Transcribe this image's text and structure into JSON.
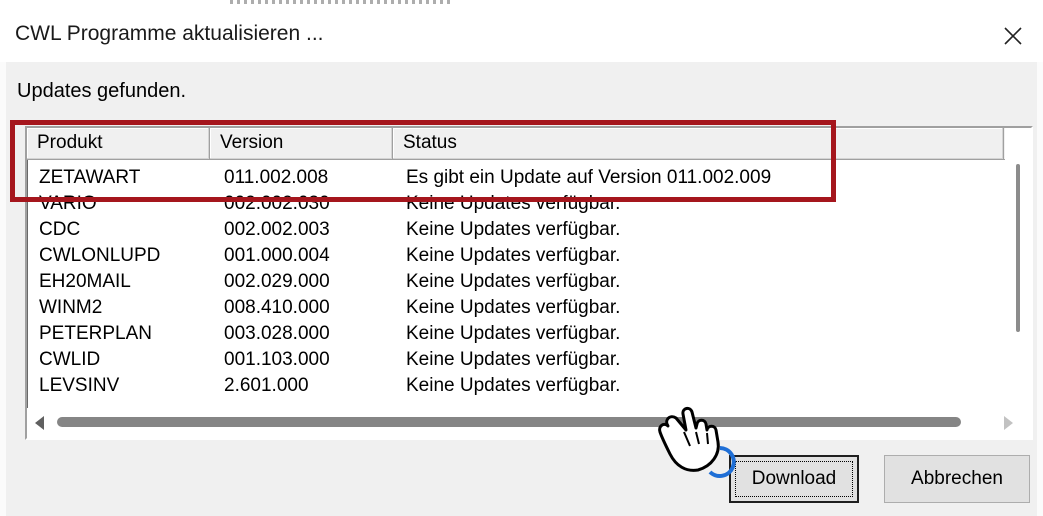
{
  "window": {
    "title": "CWL Programme aktualisieren ...",
    "close_glyph": "✕"
  },
  "message": "Updates gefunden.",
  "table": {
    "columns": [
      "Produkt",
      "Version",
      "Status"
    ],
    "rows": [
      {
        "product": "ZETAWART",
        "version": "011.002.008",
        "status": "Es gibt ein Update auf Version 011.002.009"
      },
      {
        "product": "VARIO",
        "version": "002.002.030",
        "status": "Keine Updates verfügbar."
      },
      {
        "product": "CDC",
        "version": "002.002.003",
        "status": "Keine Updates verfügbar."
      },
      {
        "product": "CWLONLUPD",
        "version": "001.000.004",
        "status": "Keine Updates verfügbar."
      },
      {
        "product": "EH20MAIL",
        "version": "002.029.000",
        "status": "Keine Updates verfügbar."
      },
      {
        "product": "WINM2",
        "version": "008.410.000",
        "status": "Keine Updates verfügbar."
      },
      {
        "product": "PETERPLAN",
        "version": "003.028.000",
        "status": "Keine Updates verfügbar."
      },
      {
        "product": "CWLID",
        "version": "001.103.000",
        "status": "Keine Updates verfügbar."
      },
      {
        "product": "LEVSINV",
        "version": "2.601.000",
        "status": "Keine Updates verfügbar."
      }
    ]
  },
  "buttons": {
    "download": "Download",
    "cancel": "Abbrechen"
  },
  "annotation": {
    "highlight_color": "#a5161d"
  },
  "icons": {
    "close": "close-icon",
    "cursor": "hand-pointer-icon"
  }
}
